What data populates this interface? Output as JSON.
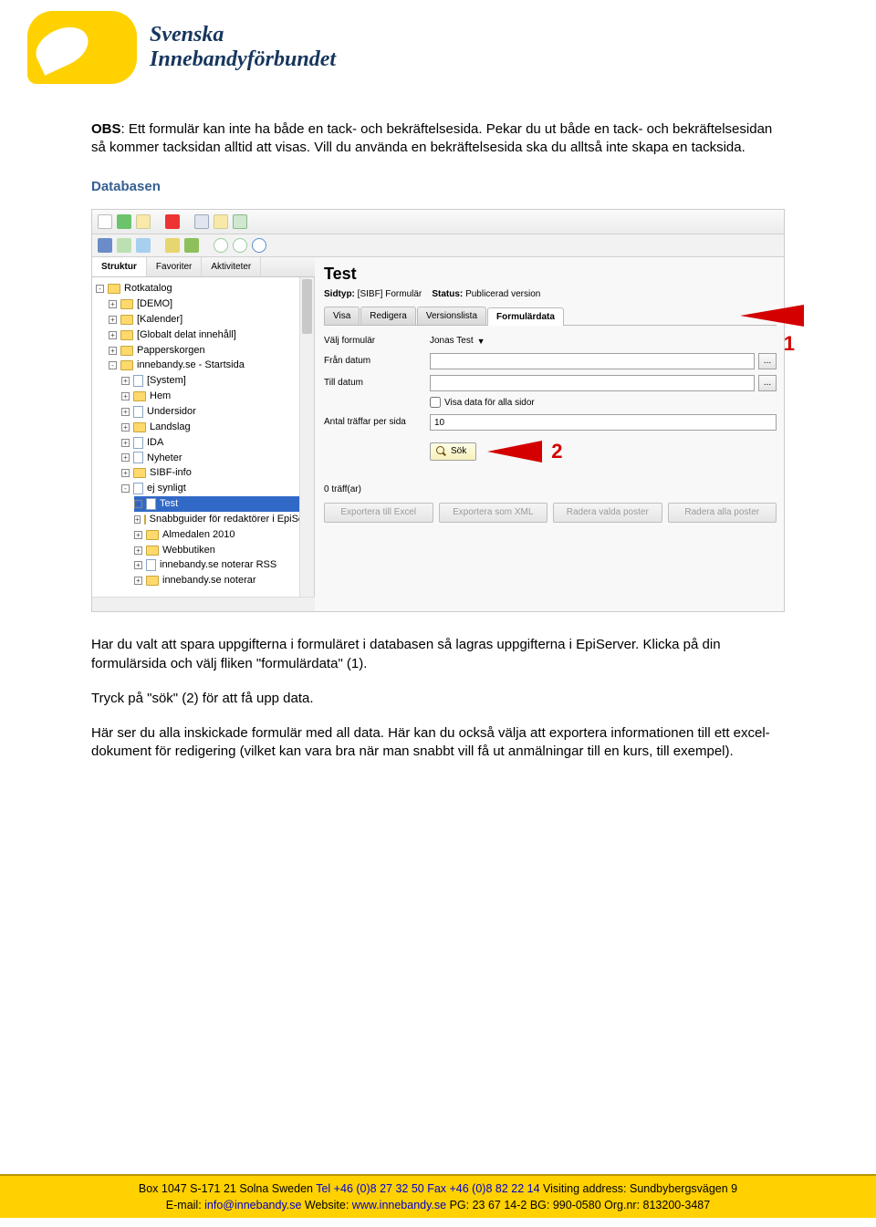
{
  "logo": {
    "line1": "Svenska",
    "line2": "Innebandyförbundet"
  },
  "para1_strong": "OBS",
  "para1_rest": ": Ett formulär kan inte ha både en tack- och bekräftelsesida. Pekar du ut både en tack- och bekräftelsesidan så kommer tacksidan alltid att visas. Vill du använda en bekräftelsesida ska du alltså inte skapa en tacksida.",
  "section_head": "Databasen",
  "para2": "Har du valt att spara uppgifterna i formuläret i databasen så lagras uppgifterna i EpiServer. Klicka på din formulärsida och välj fliken \"formulärdata\" (1).",
  "para3": "Tryck på \"sök\" (2) för att få upp data.",
  "para4": "Här ser du alla inskickade formulär med all data. Här kan du också välja att exportera informationen till ett excel-dokument för redigering (vilket kan vara bra när man snabbt vill få ut anmälningar till en kurs, till exempel).",
  "shot": {
    "left_tabs": [
      "Struktur",
      "Favoriter",
      "Aktiviteter"
    ],
    "tree": [
      {
        "toggle": "-",
        "lvl": 0,
        "ico": "fld",
        "label": "Rotkatalog",
        "sel": false
      },
      {
        "toggle": "+",
        "lvl": 1,
        "ico": "fld",
        "label": "[DEMO]"
      },
      {
        "toggle": "+",
        "lvl": 1,
        "ico": "fld",
        "label": "[Kalender]"
      },
      {
        "toggle": "+",
        "lvl": 1,
        "ico": "fld",
        "label": "[Globalt delat innehåll]"
      },
      {
        "toggle": "+",
        "lvl": 1,
        "ico": "fld",
        "label": "Papperskorgen"
      },
      {
        "toggle": "-",
        "lvl": 1,
        "ico": "fld",
        "label": "innebandy.se - Startsida"
      },
      {
        "toggle": "+",
        "lvl": 2,
        "ico": "page",
        "label": "[System]"
      },
      {
        "toggle": "+",
        "lvl": 2,
        "ico": "fld",
        "label": "Hem"
      },
      {
        "toggle": "+",
        "lvl": 2,
        "ico": "page",
        "label": "Undersidor"
      },
      {
        "toggle": "+",
        "lvl": 2,
        "ico": "fld",
        "label": "Landslag"
      },
      {
        "toggle": "+",
        "lvl": 2,
        "ico": "page",
        "label": "IDA"
      },
      {
        "toggle": "+",
        "lvl": 2,
        "ico": "page",
        "label": "Nyheter"
      },
      {
        "toggle": "+",
        "lvl": 2,
        "ico": "fld",
        "label": "SIBF-info"
      },
      {
        "toggle": "-",
        "lvl": 2,
        "ico": "page",
        "label": "ej synligt"
      },
      {
        "toggle": "-",
        "lvl": 3,
        "ico": "page",
        "label": "Test",
        "sel": true
      },
      {
        "toggle": "+",
        "lvl": 3,
        "ico": "fld",
        "label": "Snabbguider för redaktörer i EpiServer"
      },
      {
        "toggle": "+",
        "lvl": 3,
        "ico": "fld",
        "label": "Almedalen 2010"
      },
      {
        "toggle": "+",
        "lvl": 3,
        "ico": "fld",
        "label": "Webbutiken"
      },
      {
        "toggle": "+",
        "lvl": 3,
        "ico": "page",
        "label": "innebandy.se noterar RSS"
      },
      {
        "toggle": "+",
        "lvl": 3,
        "ico": "fld",
        "label": "innebandy.se noterar"
      }
    ],
    "page_title": "Test",
    "meta_sidtyp_label": "Sidtyp:",
    "meta_sidtyp_value": "[SIBF] Formulär",
    "meta_status_label": "Status:",
    "meta_status_value": "Publicerad version",
    "rtabs": [
      "Visa",
      "Redigera",
      "Versionslista",
      "Formulärdata"
    ],
    "rtab_active": 3,
    "num1": "1",
    "num2": "2",
    "form_labels": {
      "valj": "Välj formulär",
      "fran": "Från datum",
      "till": "Till datum",
      "visa_alla": "Visa data för alla sidor",
      "antal": "Antal träffar per sida"
    },
    "valj_value": "Jonas Test",
    "antal_value": "10",
    "sok_label": "Sök",
    "hits": "0 träff(ar)",
    "export_btns": [
      "Exportera till Excel",
      "Exportera som XML",
      "Radera valda poster",
      "Radera alla poster"
    ]
  },
  "footer": {
    "l1_a": "Box 1047 S-171 21 Solna Sweden  ",
    "l1_b": "Tel +46 (0)8 27 32 50 Fax +46 (0)8 82 22 14",
    "l1_c": " Visiting address: Sundbybergsvägen 9",
    "l2_a": "E-mail: ",
    "l2_b": "info@innebandy.se",
    "l2_c": " Website: ",
    "l2_d": "www.innebandy.se",
    "l2_e": "  PG: 23 67 14-2 BG: 990-0580 Org.nr: 813200-3487"
  }
}
